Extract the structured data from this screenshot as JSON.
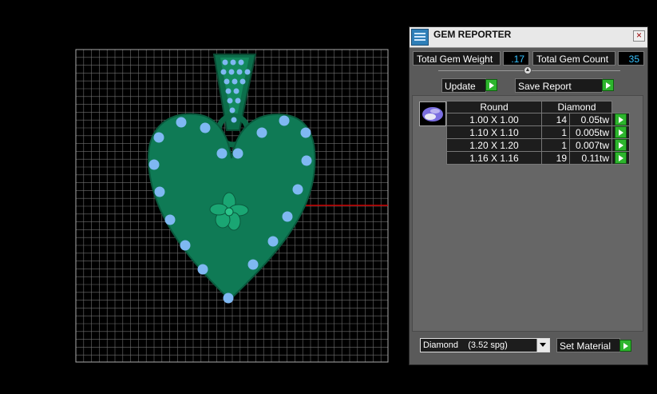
{
  "window": {
    "title": "GEM REPORTER",
    "close_symbol": "×",
    "icon_name": "gem-reporter-icon"
  },
  "stats": {
    "total_weight_label": "Total Gem Weight",
    "total_weight_value": ".17",
    "total_count_label": "Total Gem Count",
    "total_count_value": "35"
  },
  "toolbar": {
    "update_label": "Update",
    "save_report_label": "Save Report"
  },
  "gem_table": {
    "shape": "Round",
    "material": "Diamond",
    "rows": [
      {
        "size": "1.00 X 1.00",
        "count": "14",
        "weight": "0.05tw"
      },
      {
        "size": "1.10 X 1.10",
        "count": "1",
        "weight": "0.005tw"
      },
      {
        "size": "1.20 X 1.20",
        "count": "1",
        "weight": "0.007tw"
      },
      {
        "size": "1.16 X 1.16",
        "count": "19",
        "weight": "0.11tw"
      }
    ]
  },
  "material_select": {
    "selected": "Diamond    (3.52 spg)",
    "set_label": "Set Material"
  },
  "colors": {
    "metal": "#0f7a55",
    "gem": "#7fb8f2",
    "grid": "#8a8a8a",
    "accent_green": "#2db52d",
    "value_blue": "#36c2ff"
  }
}
